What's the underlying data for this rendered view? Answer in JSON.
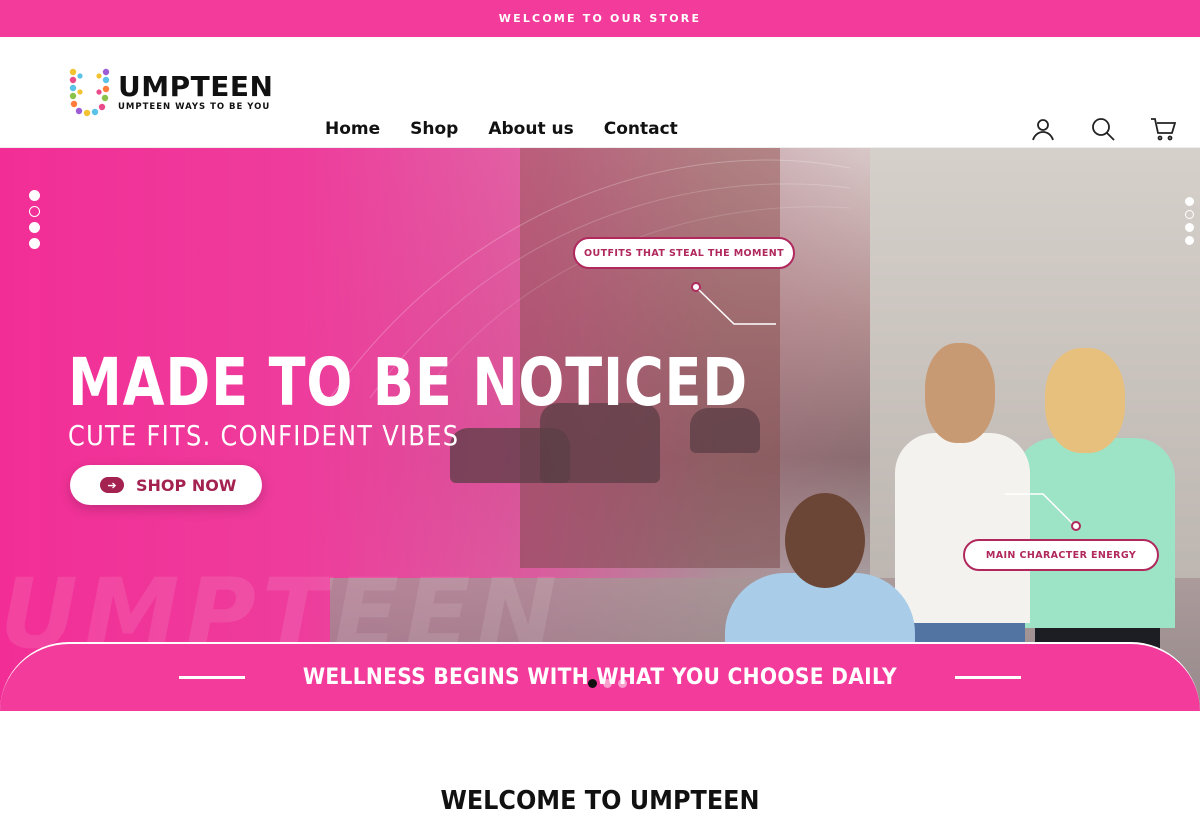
{
  "announcement": {
    "text": "WELCOME TO OUR STORE"
  },
  "brand": {
    "name": "UMPTEEN",
    "tagline": "UMPTEEN WAYS TO BE YOU",
    "color": "#f23b9b"
  },
  "nav": {
    "items": [
      {
        "label": "Home"
      },
      {
        "label": "Shop"
      },
      {
        "label": "About us"
      },
      {
        "label": "Contact"
      }
    ]
  },
  "header_icons": [
    "account-icon",
    "search-icon",
    "cart-icon"
  ],
  "hero": {
    "watermark": "UMPTEEN",
    "headline": "MADE TO BE NOTICED",
    "subline": "CUTE FITS. CONFIDENT VIBES",
    "cta_label": "SHOP NOW",
    "tag_top": "OUTFITS THAT STEAL THE MOMENT",
    "tag_bottom": "MAIN CHARACTER ENERGY",
    "banner_text": "WELLNESS BEGINS WITH WHAT YOU CHOOSE DAILY"
  },
  "welcome": {
    "title": "WELCOME TO UMPTEEN"
  }
}
